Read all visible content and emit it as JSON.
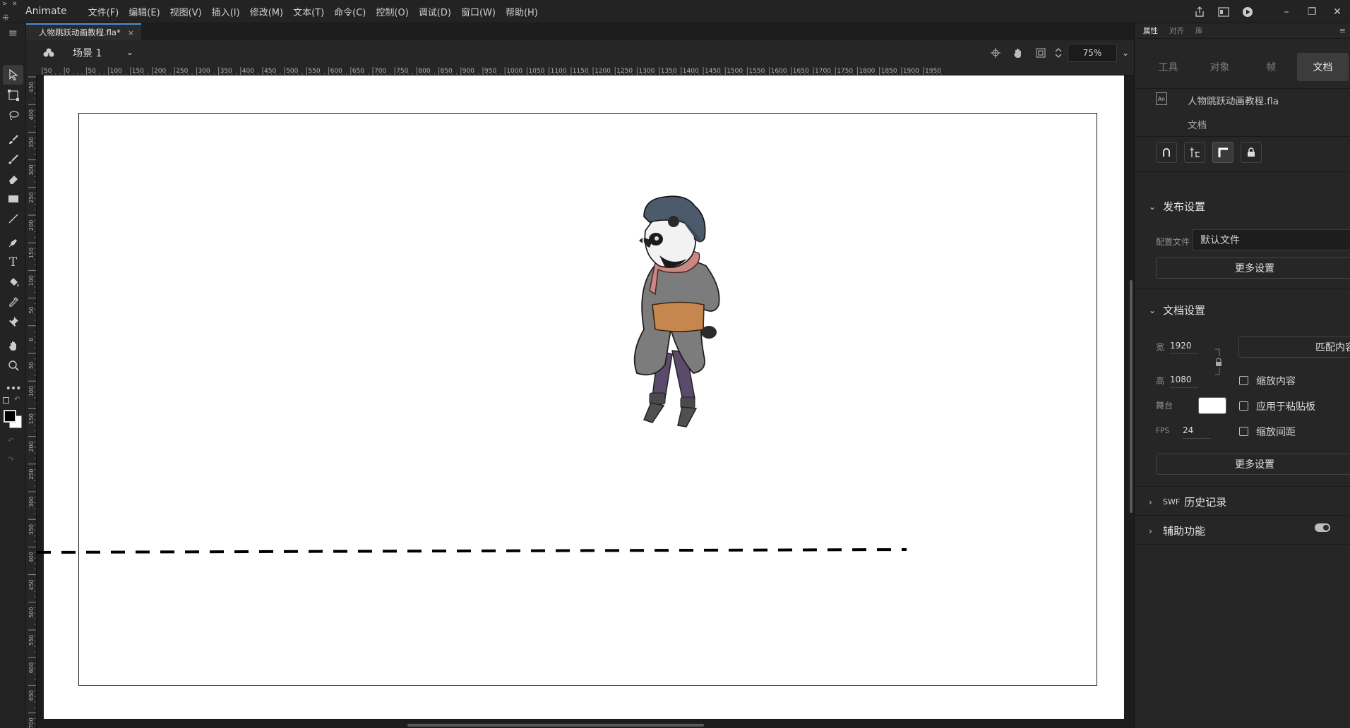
{
  "app": {
    "name": "Animate",
    "menu": [
      "文件(F)",
      "编辑(E)",
      "视图(V)",
      "插入(I)",
      "修改(M)",
      "文本(T)",
      "命令(C)",
      "控制(O)",
      "调试(D)",
      "窗口(W)",
      "帮助(H)"
    ]
  },
  "document": {
    "tab_title": "人物跳跃动画教程.fla*",
    "tab_close": "×"
  },
  "scene": {
    "label": "场景 1",
    "zoom": "75%"
  },
  "rulers": {
    "horizontal_ticks": [
      "50",
      "0",
      "50",
      "100",
      "150",
      "200",
      "250",
      "300",
      "350",
      "400",
      "450",
      "500",
      "550",
      "600",
      "650",
      "700",
      "750",
      "800",
      "850",
      "900",
      "950",
      "1000",
      "1050",
      "1100",
      "1150",
      "1200",
      "1250",
      "1300",
      "1350",
      "1400",
      "1450",
      "1500",
      "1550",
      "1600",
      "1650",
      "1700",
      "1750",
      "1800",
      "1850",
      "1900",
      "1950"
    ],
    "vertical_ticks": [
      "450",
      "400",
      "350",
      "300",
      "250",
      "200",
      "150",
      "100",
      "50",
      "0",
      "50",
      "100",
      "150",
      "200",
      "250",
      "300",
      "350",
      "400",
      "450",
      "500",
      "550",
      "600",
      "650",
      "700"
    ]
  },
  "panel": {
    "tabs": [
      "属性",
      "对齐",
      "库"
    ],
    "active_tab": "属性",
    "segments": [
      "工具",
      "对象",
      "帧",
      "文档"
    ],
    "active_segment": "文档",
    "doc_icon": "An",
    "doc_name": "人物跳跃动画教程.fla",
    "doc_type": "文档",
    "publish": {
      "heading": "发布设置",
      "profile_label": "配置文件",
      "profile_value": "默认文件",
      "more_button": "更多设置"
    },
    "doc_settings": {
      "heading": "文档设置",
      "width_label": "宽",
      "width_value": "1920",
      "height_label": "高",
      "height_value": "1080",
      "match_button": "匹配内容",
      "scale_content": "缩放内容",
      "stage_label": "舞台",
      "apply_pasteboard": "应用于粘贴板",
      "fps_label": "FPS",
      "fps_value": "24",
      "scale_spacing": "缩放间距",
      "more_button": "更多设置",
      "stage_color": "#ffffff"
    },
    "swf_history": {
      "prefix": "SWF",
      "heading": "历史记录"
    },
    "accessibility": {
      "heading": "辅助功能",
      "enabled": true
    }
  },
  "colors": {
    "ui_bg": "#232323",
    "panel_bg": "#262626",
    "stage": "#ffffff",
    "accent": "#4a90d9"
  }
}
